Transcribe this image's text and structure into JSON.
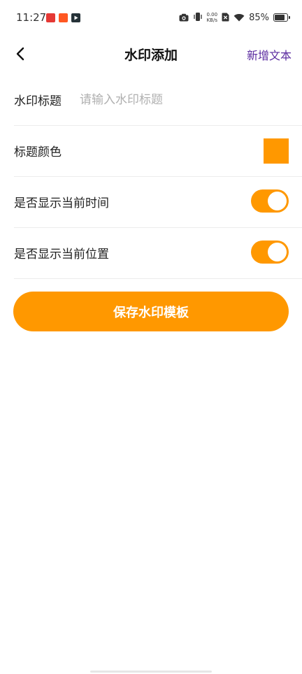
{
  "status_bar": {
    "time": "11:27",
    "net_speed_value": "0.00",
    "net_speed_unit": "KB/s",
    "battery_percent": "85%",
    "battery_level": 0.85
  },
  "nav": {
    "title": "水印添加",
    "action_label": "新增文本",
    "back_icon": "chevron-left-icon"
  },
  "form": {
    "title_label": "水印标题",
    "title_value": "",
    "title_placeholder": "请输入水印标题",
    "color_label": "标题颜色",
    "color_value": "#ff9800",
    "show_time_label": "是否显示当前时间",
    "show_time_on": true,
    "show_location_label": "是否显示当前位置",
    "show_location_on": true
  },
  "save_button_label": "保存水印模板",
  "colors": {
    "accent": "#ff9800",
    "action_text": "#5b2ca0"
  }
}
